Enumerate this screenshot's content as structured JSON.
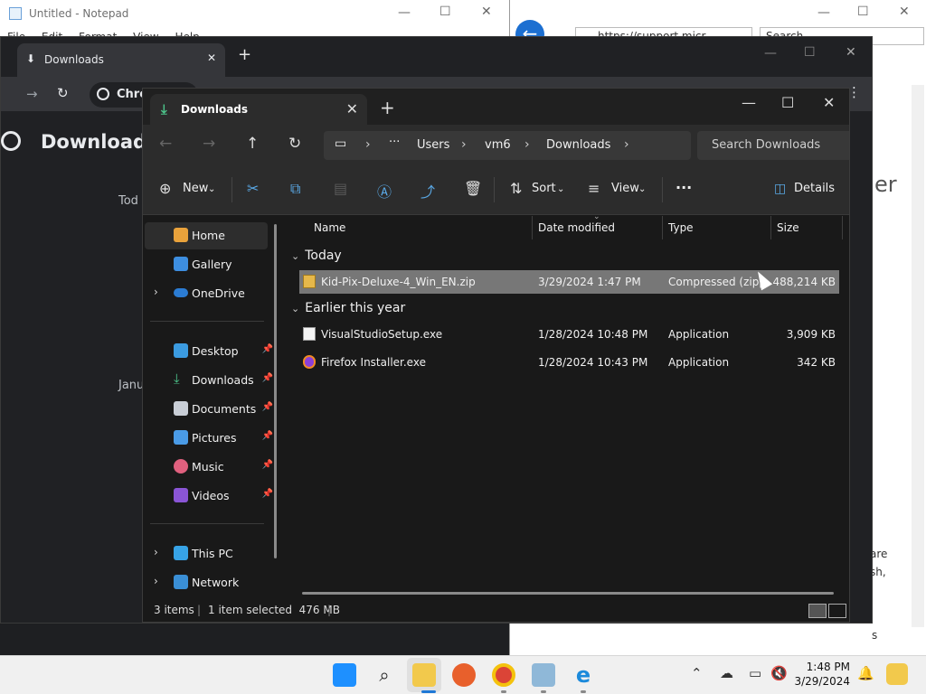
{
  "notepad": {
    "title": "Untitled - Notepad",
    "menu": [
      "File",
      "Edit",
      "Format",
      "View",
      "Help"
    ]
  },
  "edge": {
    "address": "https://support.micr...",
    "search_placeholder": "Search",
    "side_text_1": "er",
    "side_text_2": "are",
    "side_text_3": "sh,",
    "side_text_4": "s"
  },
  "chrome": {
    "tab_title": "Downloads",
    "omnibox_label": "Chrome",
    "page_heading": "Downloads",
    "today_label": "Tod",
    "january_label": "Janu"
  },
  "explorer": {
    "tab_title": "Downloads",
    "breadcrumb": [
      "Users",
      "vm6",
      "Downloads"
    ],
    "search_placeholder": "Search Downloads",
    "toolbar": {
      "new_label": "New",
      "sort_label": "Sort",
      "view_label": "View",
      "more_label": "···",
      "details_label": "Details"
    },
    "nav": {
      "home": "Home",
      "gallery": "Gallery",
      "onedrive": "OneDrive",
      "desktop": "Desktop",
      "downloads": "Downloads",
      "documents": "Documents",
      "pictures": "Pictures",
      "music": "Music",
      "videos": "Videos",
      "thispc": "This PC",
      "network": "Network"
    },
    "columns": {
      "name": "Name",
      "date": "Date modified",
      "type": "Type",
      "size": "Size"
    },
    "groups": {
      "today": "Today",
      "earlier": "Earlier this year"
    },
    "files": [
      {
        "name": "Kid-Pix-Deluxe-4_Win_EN.zip",
        "date": "3/29/2024 1:47 PM",
        "type": "Compressed (zipp",
        "size": "488,214 KB"
      },
      {
        "name": "VisualStudioSetup.exe",
        "date": "1/28/2024 10:48 PM",
        "type": "Application",
        "size": "3,909 KB"
      },
      {
        "name": "Firefox Installer.exe",
        "date": "1/28/2024 10:43 PM",
        "type": "Application",
        "size": "342 KB"
      }
    ],
    "status": {
      "items": "3 items",
      "selected": "1 item selected  476 MB"
    }
  },
  "taskbar": {
    "time": "1:48 PM",
    "date": "3/29/2024"
  },
  "colors": {
    "accent": "#4cc38a",
    "selection": "#777777",
    "explorer_bg": "#191919"
  }
}
